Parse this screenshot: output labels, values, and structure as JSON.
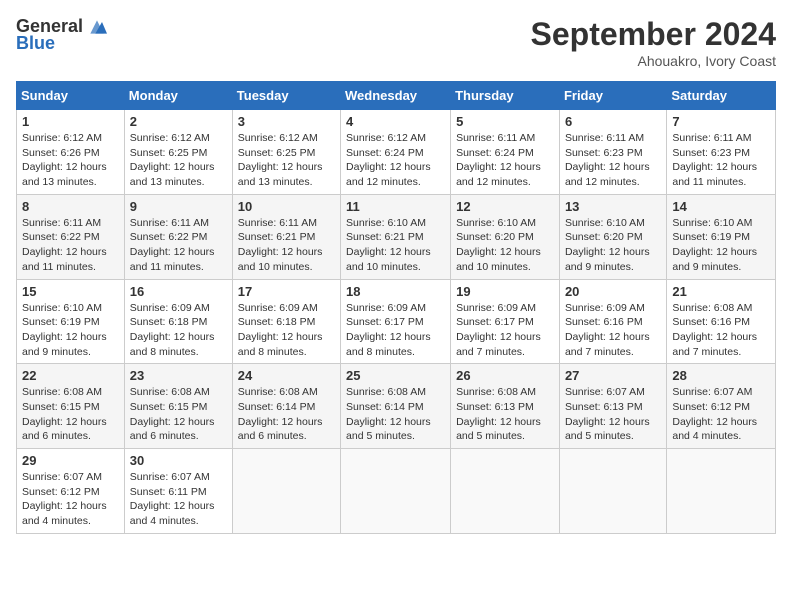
{
  "header": {
    "logo_general": "General",
    "logo_blue": "Blue",
    "month_title": "September 2024",
    "subtitle": "Ahouakro, Ivory Coast"
  },
  "calendar": {
    "days_of_week": [
      "Sunday",
      "Monday",
      "Tuesday",
      "Wednesday",
      "Thursday",
      "Friday",
      "Saturday"
    ],
    "weeks": [
      [
        null,
        null,
        null,
        null,
        null,
        null,
        null
      ]
    ],
    "cells": {
      "w1": [
        null,
        null,
        null,
        null,
        null,
        null,
        null
      ]
    }
  },
  "days": {
    "1": {
      "num": "1",
      "sunrise": "Sunrise: 6:12 AM",
      "sunset": "Sunset: 6:26 PM",
      "daylight": "Daylight: 12 hours and 13 minutes."
    },
    "2": {
      "num": "2",
      "sunrise": "Sunrise: 6:12 AM",
      "sunset": "Sunset: 6:25 PM",
      "daylight": "Daylight: 12 hours and 13 minutes."
    },
    "3": {
      "num": "3",
      "sunrise": "Sunrise: 6:12 AM",
      "sunset": "Sunset: 6:25 PM",
      "daylight": "Daylight: 12 hours and 13 minutes."
    },
    "4": {
      "num": "4",
      "sunrise": "Sunrise: 6:12 AM",
      "sunset": "Sunset: 6:24 PM",
      "daylight": "Daylight: 12 hours and 12 minutes."
    },
    "5": {
      "num": "5",
      "sunrise": "Sunrise: 6:11 AM",
      "sunset": "Sunset: 6:24 PM",
      "daylight": "Daylight: 12 hours and 12 minutes."
    },
    "6": {
      "num": "6",
      "sunrise": "Sunrise: 6:11 AM",
      "sunset": "Sunset: 6:23 PM",
      "daylight": "Daylight: 12 hours and 12 minutes."
    },
    "7": {
      "num": "7",
      "sunrise": "Sunrise: 6:11 AM",
      "sunset": "Sunset: 6:23 PM",
      "daylight": "Daylight: 12 hours and 11 minutes."
    },
    "8": {
      "num": "8",
      "sunrise": "Sunrise: 6:11 AM",
      "sunset": "Sunset: 6:22 PM",
      "daylight": "Daylight: 12 hours and 11 minutes."
    },
    "9": {
      "num": "9",
      "sunrise": "Sunrise: 6:11 AM",
      "sunset": "Sunset: 6:22 PM",
      "daylight": "Daylight: 12 hours and 11 minutes."
    },
    "10": {
      "num": "10",
      "sunrise": "Sunrise: 6:11 AM",
      "sunset": "Sunset: 6:21 PM",
      "daylight": "Daylight: 12 hours and 10 minutes."
    },
    "11": {
      "num": "11",
      "sunrise": "Sunrise: 6:10 AM",
      "sunset": "Sunset: 6:21 PM",
      "daylight": "Daylight: 12 hours and 10 minutes."
    },
    "12": {
      "num": "12",
      "sunrise": "Sunrise: 6:10 AM",
      "sunset": "Sunset: 6:20 PM",
      "daylight": "Daylight: 12 hours and 10 minutes."
    },
    "13": {
      "num": "13",
      "sunrise": "Sunrise: 6:10 AM",
      "sunset": "Sunset: 6:20 PM",
      "daylight": "Daylight: 12 hours and 9 minutes."
    },
    "14": {
      "num": "14",
      "sunrise": "Sunrise: 6:10 AM",
      "sunset": "Sunset: 6:19 PM",
      "daylight": "Daylight: 12 hours and 9 minutes."
    },
    "15": {
      "num": "15",
      "sunrise": "Sunrise: 6:10 AM",
      "sunset": "Sunset: 6:19 PM",
      "daylight": "Daylight: 12 hours and 9 minutes."
    },
    "16": {
      "num": "16",
      "sunrise": "Sunrise: 6:09 AM",
      "sunset": "Sunset: 6:18 PM",
      "daylight": "Daylight: 12 hours and 8 minutes."
    },
    "17": {
      "num": "17",
      "sunrise": "Sunrise: 6:09 AM",
      "sunset": "Sunset: 6:18 PM",
      "daylight": "Daylight: 12 hours and 8 minutes."
    },
    "18": {
      "num": "18",
      "sunrise": "Sunrise: 6:09 AM",
      "sunset": "Sunset: 6:17 PM",
      "daylight": "Daylight: 12 hours and 8 minutes."
    },
    "19": {
      "num": "19",
      "sunrise": "Sunrise: 6:09 AM",
      "sunset": "Sunset: 6:17 PM",
      "daylight": "Daylight: 12 hours and 7 minutes."
    },
    "20": {
      "num": "20",
      "sunrise": "Sunrise: 6:09 AM",
      "sunset": "Sunset: 6:16 PM",
      "daylight": "Daylight: 12 hours and 7 minutes."
    },
    "21": {
      "num": "21",
      "sunrise": "Sunrise: 6:08 AM",
      "sunset": "Sunset: 6:16 PM",
      "daylight": "Daylight: 12 hours and 7 minutes."
    },
    "22": {
      "num": "22",
      "sunrise": "Sunrise: 6:08 AM",
      "sunset": "Sunset: 6:15 PM",
      "daylight": "Daylight: 12 hours and 6 minutes."
    },
    "23": {
      "num": "23",
      "sunrise": "Sunrise: 6:08 AM",
      "sunset": "Sunset: 6:15 PM",
      "daylight": "Daylight: 12 hours and 6 minutes."
    },
    "24": {
      "num": "24",
      "sunrise": "Sunrise: 6:08 AM",
      "sunset": "Sunset: 6:14 PM",
      "daylight": "Daylight: 12 hours and 6 minutes."
    },
    "25": {
      "num": "25",
      "sunrise": "Sunrise: 6:08 AM",
      "sunset": "Sunset: 6:14 PM",
      "daylight": "Daylight: 12 hours and 5 minutes."
    },
    "26": {
      "num": "26",
      "sunrise": "Sunrise: 6:08 AM",
      "sunset": "Sunset: 6:13 PM",
      "daylight": "Daylight: 12 hours and 5 minutes."
    },
    "27": {
      "num": "27",
      "sunrise": "Sunrise: 6:07 AM",
      "sunset": "Sunset: 6:13 PM",
      "daylight": "Daylight: 12 hours and 5 minutes."
    },
    "28": {
      "num": "28",
      "sunrise": "Sunrise: 6:07 AM",
      "sunset": "Sunset: 6:12 PM",
      "daylight": "Daylight: 12 hours and 4 minutes."
    },
    "29": {
      "num": "29",
      "sunrise": "Sunrise: 6:07 AM",
      "sunset": "Sunset: 6:12 PM",
      "daylight": "Daylight: 12 hours and 4 minutes."
    },
    "30": {
      "num": "30",
      "sunrise": "Sunrise: 6:07 AM",
      "sunset": "Sunset: 6:11 PM",
      "daylight": "Daylight: 12 hours and 4 minutes."
    }
  }
}
